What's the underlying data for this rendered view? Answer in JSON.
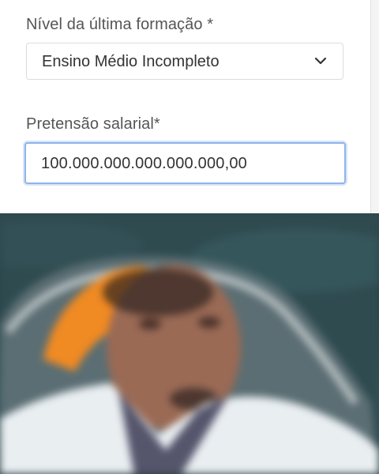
{
  "form": {
    "education": {
      "label": "Nível da última formação *",
      "selected": "Ensino Médio Incompleto",
      "icon": "chevron-down-icon"
    },
    "salary": {
      "label": "Pretensão salarial*",
      "value": "100.000.000.000.000.000,00"
    }
  },
  "colors": {
    "focus_border": "#8fb4ec",
    "label_text": "#555555",
    "value_text": "#333333"
  }
}
